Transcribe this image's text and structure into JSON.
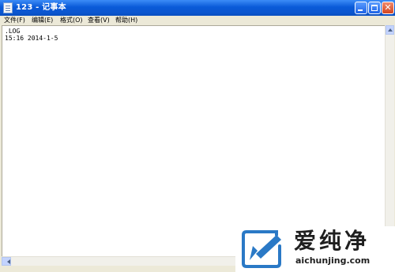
{
  "window": {
    "title": "123 - 记事本"
  },
  "menu": {
    "items": [
      {
        "label": "文件(F)"
      },
      {
        "label": "编辑(E)"
      },
      {
        "label": "格式(O)"
      },
      {
        "label": "查看(V)"
      },
      {
        "label": "帮助(H)"
      }
    ]
  },
  "editor": {
    "lines": [
      ".LOG",
      "15:16 2014-1-5"
    ]
  },
  "watermark": {
    "main_text": "爱纯净",
    "url_text": "aichunjing.com"
  },
  "colors": {
    "titlebar": "#0a5ad8",
    "close_button": "#d2451f",
    "logo_blue": "#2a79c6"
  },
  "icons": {
    "app": "notepad-icon",
    "minimize": "minimize-icon",
    "maximize": "maximize-icon",
    "close": "close-icon"
  }
}
